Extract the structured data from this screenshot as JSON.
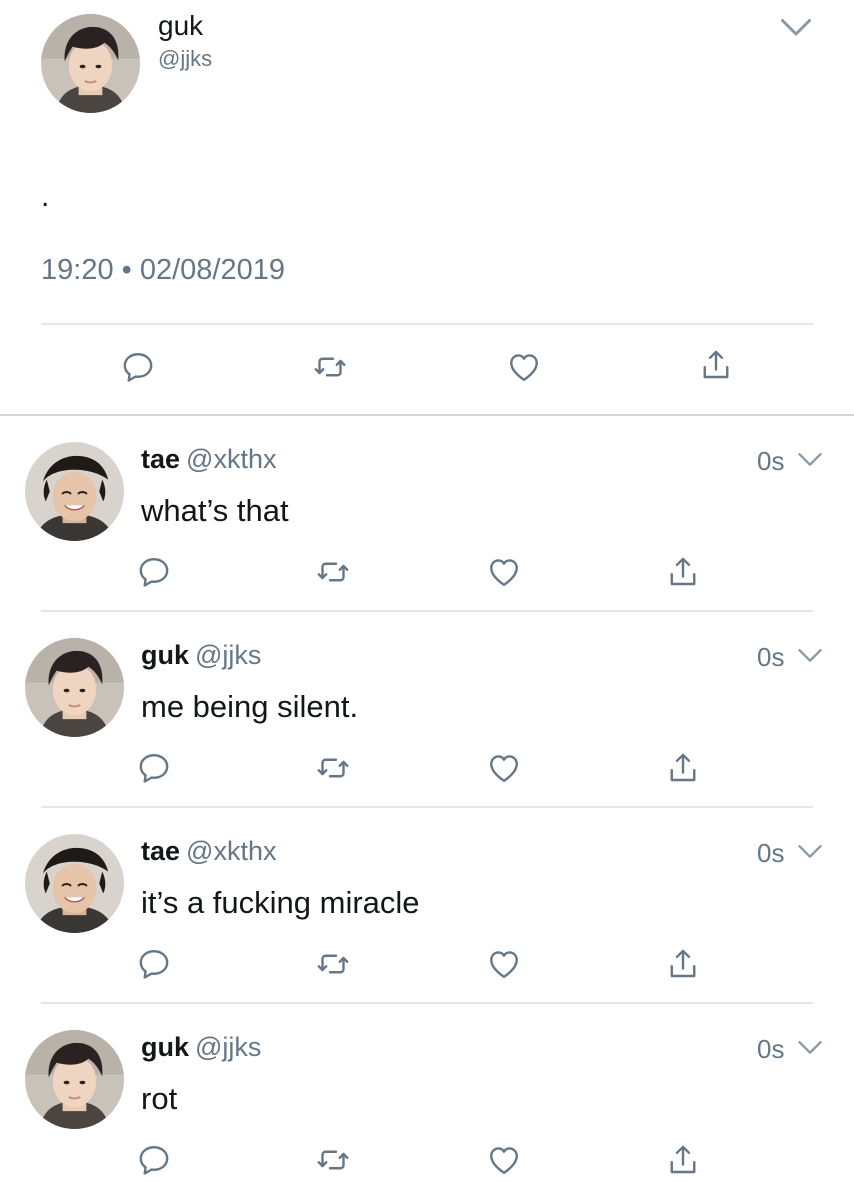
{
  "main_tweet": {
    "name": "guk",
    "handle": "@jjks",
    "body": ".",
    "timestamp": "19:20 • 02/08/2019"
  },
  "replies": [
    {
      "name": "tae",
      "handle": "@xkthx",
      "time": "0s",
      "text": "what’s that"
    },
    {
      "name": "guk",
      "handle": "@jjks",
      "time": "0s",
      "text": "me being silent."
    },
    {
      "name": "tae",
      "handle": "@xkthx",
      "time": "0s",
      "text": "it’s a fucking miracle"
    },
    {
      "name": "guk",
      "handle": "@jjks",
      "time": "0s",
      "text": "rot"
    }
  ],
  "icons": {
    "reply": "speech-bubble-icon",
    "retweet": "retweet-icon",
    "like": "heart-icon",
    "share": "share-icon",
    "menu": "chevron-down-icon"
  },
  "colors": {
    "text": "#14171a",
    "secondary": "#657786",
    "divider": "#e1e8ed",
    "icon": "#657786"
  }
}
